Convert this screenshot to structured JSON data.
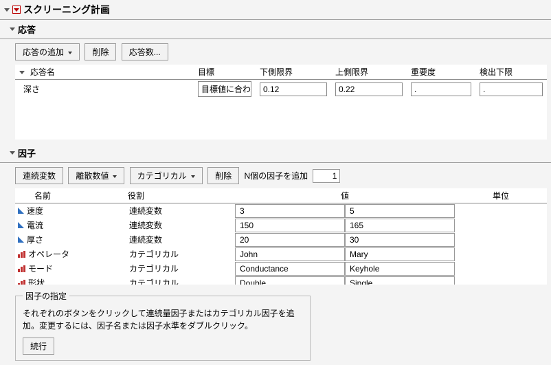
{
  "titles": {
    "main": "スクリーニング計画",
    "responses": "応答",
    "factors": "因子",
    "spec": "因子の指定"
  },
  "resp_toolbar": {
    "add": "応答の追加",
    "delete": "削除",
    "count": "応答数..."
  },
  "resp_headers": {
    "name": "応答名",
    "goal": "目標",
    "lower": "下側限界",
    "upper": "上側限界",
    "importance": "重要度",
    "detect": "検出下限"
  },
  "resp_rows": [
    {
      "name": "深さ",
      "goal": "目標値に合わせる",
      "lower": "0.12",
      "upper": "0.22",
      "importance": ".",
      "detect": "."
    }
  ],
  "factor_toolbar": {
    "continuous": "連続変数",
    "discrete": "離散数値",
    "categorical": "カテゴリカル",
    "delete": "削除",
    "addN_label": "N個の因子を追加",
    "addN_value": "1"
  },
  "factor_headers": {
    "name": "名前",
    "role": "役割",
    "value": "値",
    "unit": "単位"
  },
  "factor_rows": [
    {
      "icon": "cont",
      "name": "速度",
      "role": "連続変数",
      "v1": "3",
      "v2": "5"
    },
    {
      "icon": "cont",
      "name": "電流",
      "role": "連続変数",
      "v1": "150",
      "v2": "165"
    },
    {
      "icon": "cont",
      "name": "厚さ",
      "role": "連続変数",
      "v1": "20",
      "v2": "30"
    },
    {
      "icon": "cat",
      "name": "オペレータ",
      "role": "カテゴリカル",
      "v1": "John",
      "v2": "Mary"
    },
    {
      "icon": "cat",
      "name": "モード",
      "role": "カテゴリカル",
      "v1": "Conductance",
      "v2": "Keyhole"
    },
    {
      "icon": "cat",
      "name": "形状",
      "role": "カテゴリカル",
      "v1": "Double",
      "v2": "Single"
    }
  ],
  "spec": {
    "text": "それぞれのボタンをクリックして連続量因子またはカテゴリカル因子を追加。変更するには、因子名または因子水準をダブルクリック。",
    "continue": "続行"
  }
}
